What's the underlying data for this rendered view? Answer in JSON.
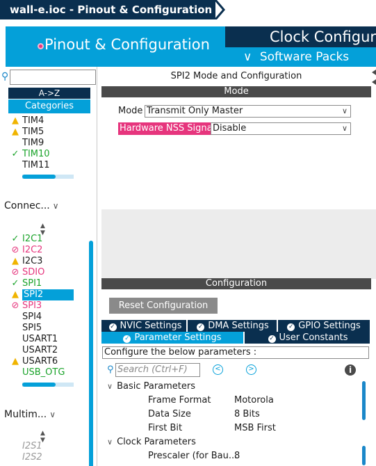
{
  "titlebar": {
    "title": "wall-e.ioc - Pinout & Configuration"
  },
  "top_tabs": {
    "pinout": "Pinout & Configuration",
    "clock": "Clock Configurat",
    "software_packs": "Software Packs"
  },
  "left": {
    "sort_label": "A->Z",
    "categories_label": "Categories",
    "timers": [
      {
        "label": "TIM4",
        "status": "warning"
      },
      {
        "label": "TIM5",
        "status": "warning"
      },
      {
        "label": "TIM9",
        "status": "none"
      },
      {
        "label": "TIM10",
        "status": "ok"
      },
      {
        "label": "TIM11",
        "status": "none"
      }
    ],
    "connectivity_group": "Connec...",
    "connectivity": [
      {
        "label": "I2C1",
        "status": "ok"
      },
      {
        "label": "I2C2",
        "status": "disabled"
      },
      {
        "label": "I2C3",
        "status": "warning"
      },
      {
        "label": "SDIO",
        "status": "disabled"
      },
      {
        "label": "SPI1",
        "status": "ok"
      },
      {
        "label": "SPI2",
        "status": "warning",
        "selected": true
      },
      {
        "label": "SPI3",
        "status": "disabled"
      },
      {
        "label": "SPI4",
        "status": "none"
      },
      {
        "label": "SPI5",
        "status": "none"
      },
      {
        "label": "USART1",
        "status": "none"
      },
      {
        "label": "USART2",
        "status": "none"
      },
      {
        "label": "USART6",
        "status": "warning"
      },
      {
        "label": "USB_OTG",
        "status": "ok"
      }
    ],
    "multimedia_group": "Multim...",
    "multimedia": [
      {
        "label": "I2S1",
        "status": "unavailable"
      },
      {
        "label": "I2S2",
        "status": "unavailable"
      }
    ]
  },
  "main": {
    "title": "SPI2 Mode and Configuration",
    "mode_section": "Mode",
    "mode_label": "Mode",
    "mode_value": "Transmit Only Master",
    "nss_label": "Hardware NSS Signal",
    "nss_value": "Disable",
    "config_section": "Configuration",
    "reset_button": "Reset Configuration",
    "tabs_row1": [
      "NVIC Settings",
      "DMA Settings",
      "GPIO Settings"
    ],
    "tabs_row2": [
      "Parameter Settings",
      "User Constants"
    ],
    "params_caption": "Configure the below parameters :",
    "search_placeholder": "Search (Ctrl+F)",
    "groups": [
      {
        "name": "Basic Parameters",
        "params": [
          {
            "name": "Frame Format",
            "value": "Motorola"
          },
          {
            "name": "Data Size",
            "value": "8 Bits"
          },
          {
            "name": "First Bit",
            "value": "MSB First"
          }
        ]
      },
      {
        "name": "Clock Parameters",
        "params": [
          {
            "name": "Prescaler (for Bau...",
            "value": "8"
          }
        ]
      }
    ]
  },
  "colors": {
    "navy": "#0a2f4f",
    "accent_blue": "#04a0d9",
    "ok_green": "#1aa32a",
    "warning_yellow": "#f0b400",
    "error_pink": "#e6357d",
    "section_gray": "#4a4a4a"
  }
}
